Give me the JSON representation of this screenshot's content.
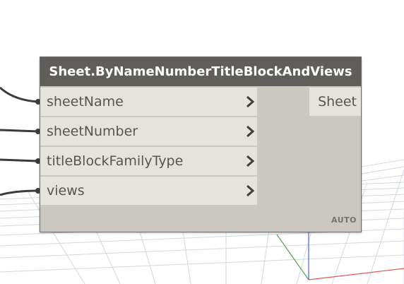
{
  "node": {
    "title": "Sheet.ByNameNumberTitleBlockAndViews",
    "inputs": [
      {
        "label": "sheetName"
      },
      {
        "label": "sheetNumber"
      },
      {
        "label": "titleBlockFamilyType"
      },
      {
        "label": "views"
      }
    ],
    "output": {
      "label": "Sheet"
    },
    "lacing": "AUTO"
  },
  "colors": {
    "header": "#5f5e5b",
    "body": "#cbc7c1",
    "port": "#e5e3de",
    "wire": "#3c3c3c",
    "grid": "#d9dee6",
    "axis_x": "#e04040",
    "axis_y": "#3aa53a",
    "axis_z": "#4060e0"
  },
  "icons": {
    "port_chevron": "chevron-right-icon",
    "wire_connector": "connector-dot-icon"
  }
}
